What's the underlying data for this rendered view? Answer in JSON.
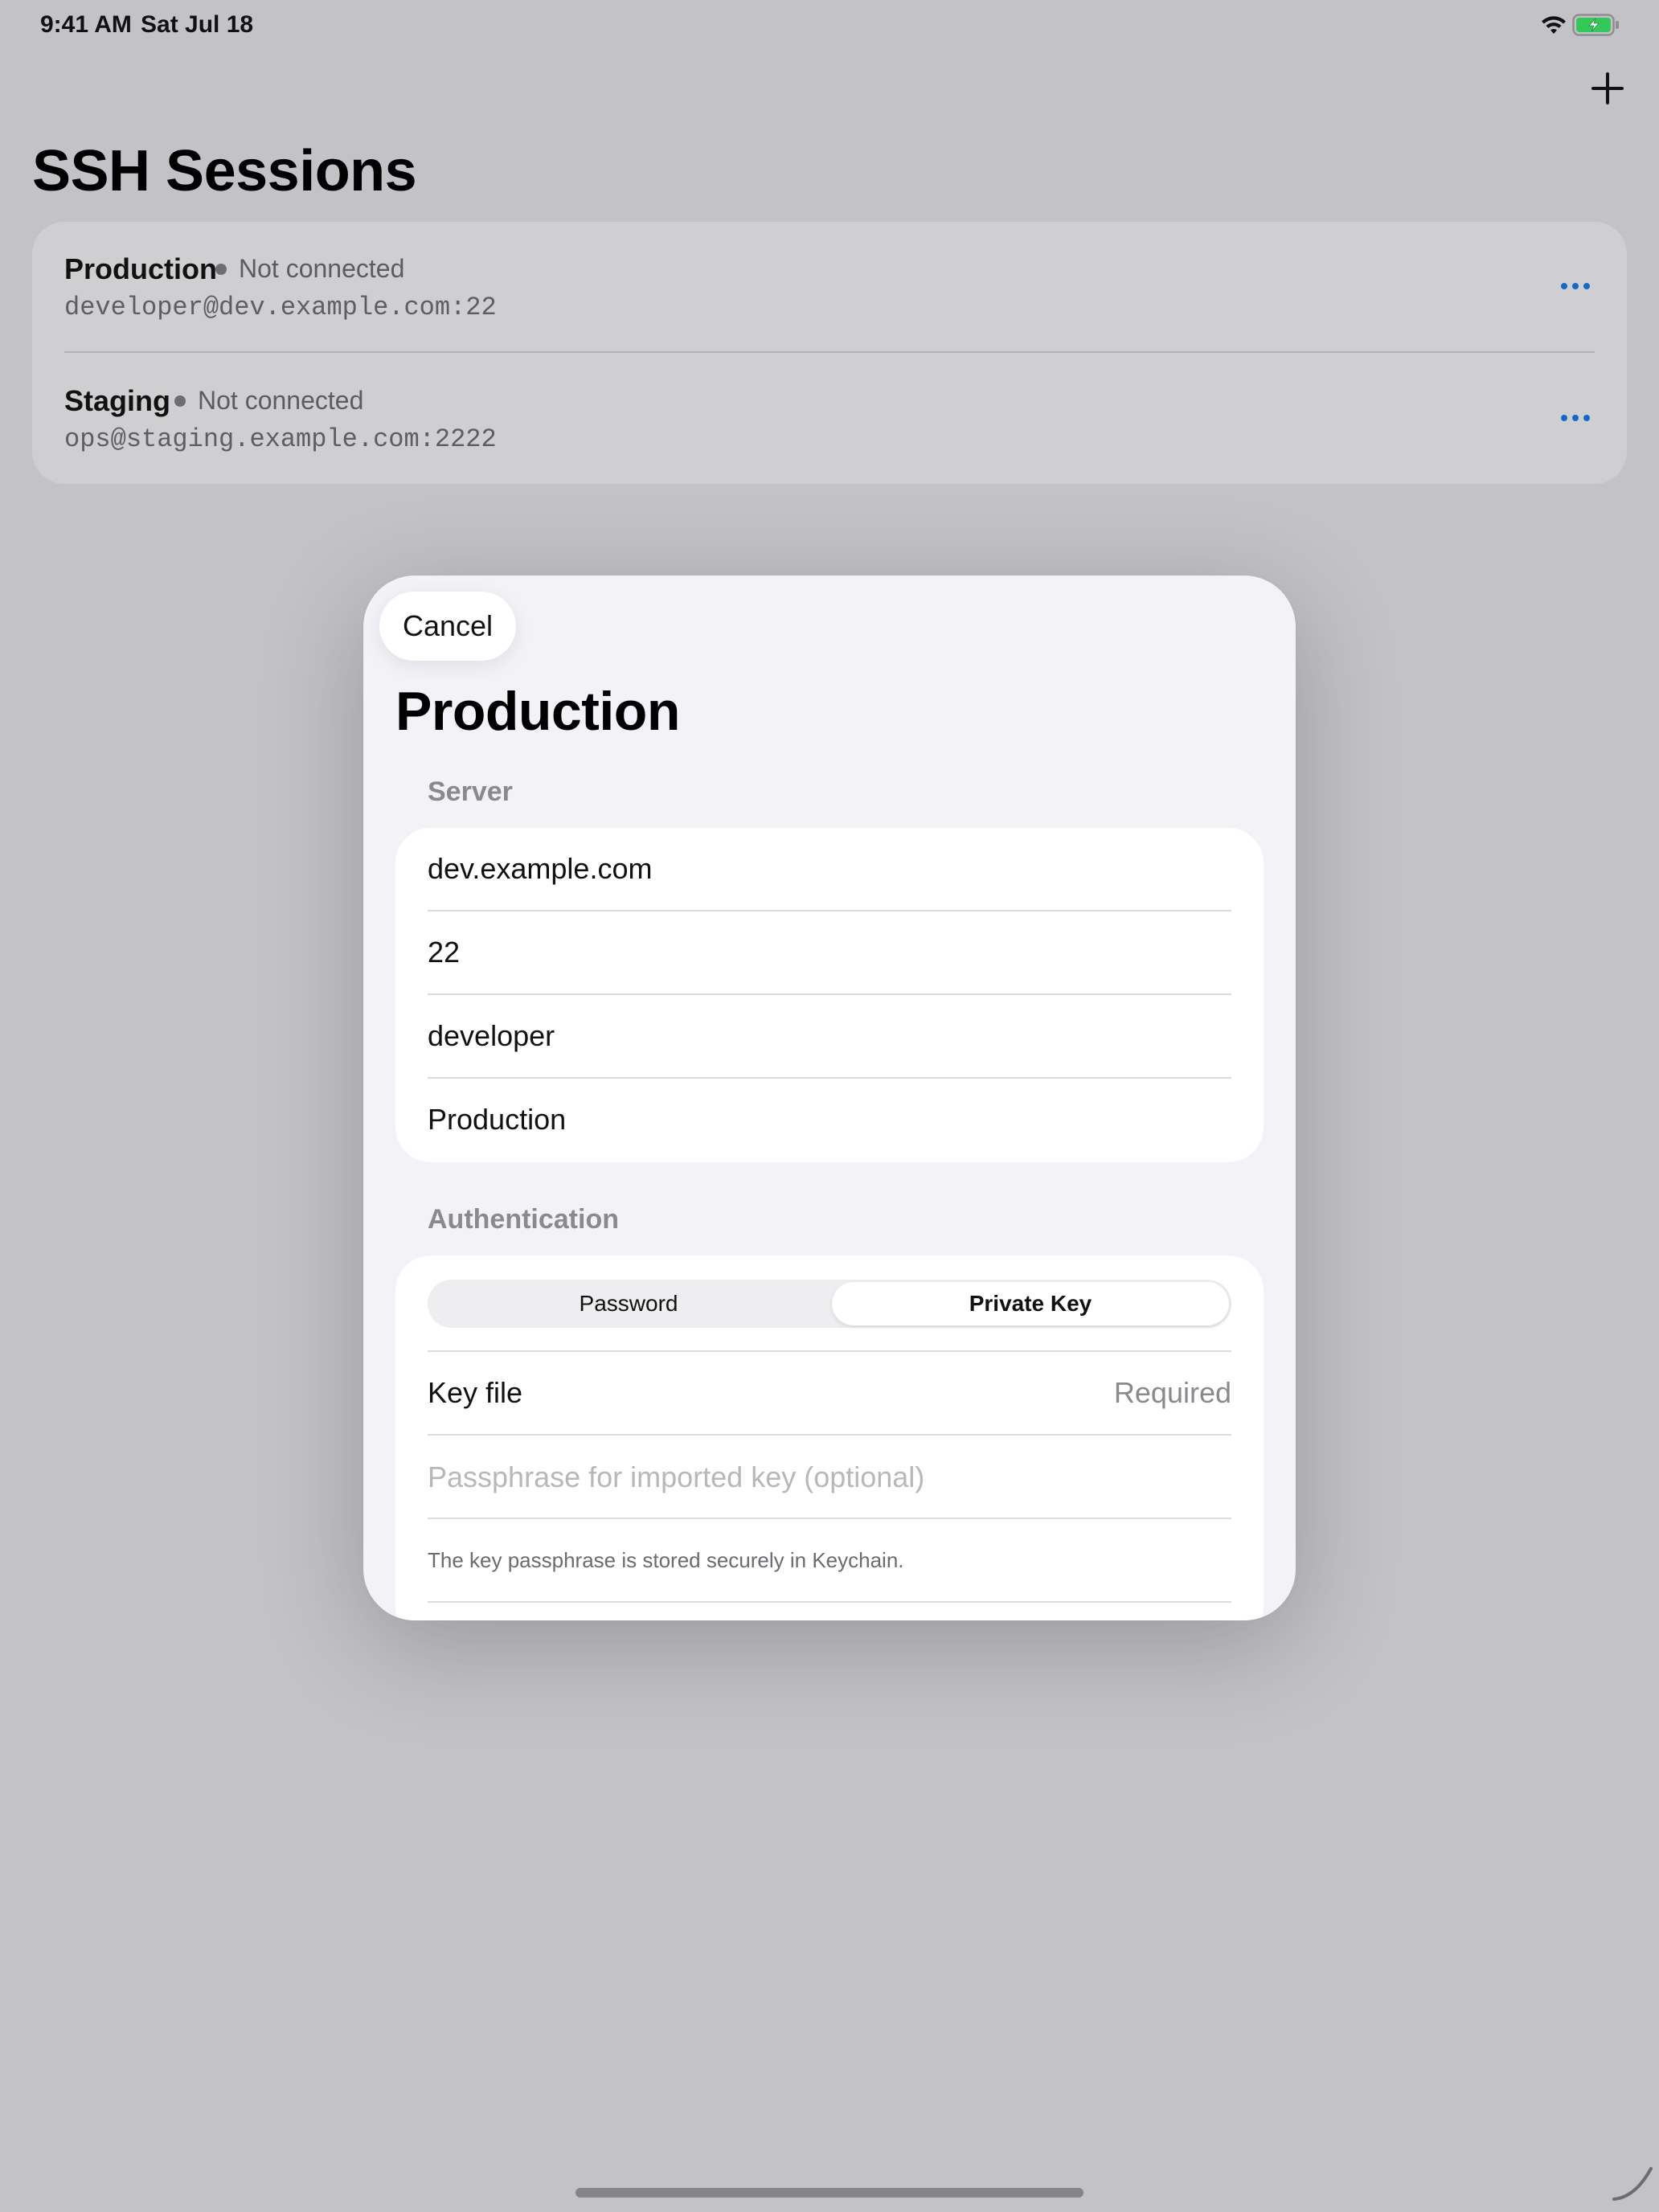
{
  "status_bar": {
    "time": "9:41 AM",
    "date": "Sat Jul 18"
  },
  "page": {
    "title": "SSH Sessions"
  },
  "sessions": [
    {
      "name": "Production",
      "status": "Not connected",
      "address": "developer@dev.example.com:22"
    },
    {
      "name": "Staging",
      "status": "Not connected",
      "address": "ops@staging.example.com:2222"
    }
  ],
  "modal": {
    "cancel_label": "Cancel",
    "title": "Production",
    "server_header": "Server",
    "server_fields": {
      "host": "dev.example.com",
      "port": "22",
      "username": "developer",
      "name": "Production"
    },
    "auth_header": "Authentication",
    "auth_segments": {
      "password": "Password",
      "private_key": "Private Key",
      "selected": "Private Key"
    },
    "key_file_label": "Key file",
    "key_file_value": "Required",
    "passphrase_placeholder": "Passphrase for imported key (optional)",
    "footnote": "The key passphrase is stored securely in Keychain."
  },
  "colors": {
    "accent": "#1a66c9",
    "battery": "#34c759"
  },
  "icons": [
    "wifi-icon",
    "battery-icon",
    "plus-icon",
    "ellipsis-icon"
  ]
}
